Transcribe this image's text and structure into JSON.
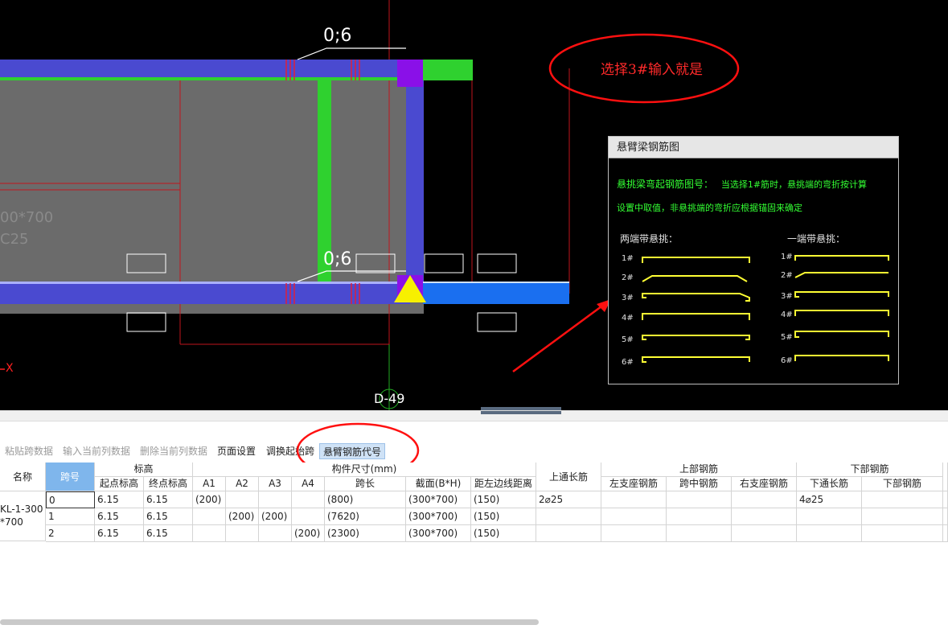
{
  "canvas": {
    "beam_label_top": "0;6",
    "beam_label_bottom": "0;6",
    "section_text": "00*700",
    "concrete_text": "C25",
    "axis_label": "D-49",
    "x_axis_label": "X"
  },
  "annotation": {
    "note": "选择3#输入就是"
  },
  "popup": {
    "title": "悬臂梁钢筋图",
    "desc_line1": "悬挑梁弯起钢筋图号：",
    "desc_line1_tail": "当选择1#筋时，悬挑端的弯折按计算",
    "desc_line2": "设置中取值，非悬挑端的弯折应根据锚固来确定",
    "group_left": "两端带悬挑：",
    "group_right": "一端带悬挑：",
    "left_labels": [
      "1#",
      "2#",
      "3#",
      "4#",
      "5#",
      "6#"
    ],
    "right_labels": [
      "1#",
      "2#",
      "3#",
      "4#",
      "5#",
      "6#"
    ]
  },
  "toolbar": {
    "paste": "粘贴跨数据",
    "input_col": "输入当前列数据",
    "delete_col": "删除当前列数据",
    "page_setup": "页面设置",
    "swap_start": "调换起始跨",
    "cantilever_code": "悬臂钢筋代号"
  },
  "table": {
    "h_name": "名称",
    "h_span": "跨号",
    "h_elev": "标高",
    "h_start_elev": "起点标高",
    "h_end_elev": "终点标高",
    "h_dims": "构件尺寸(mm)",
    "h_a1": "A1",
    "h_a2": "A2",
    "h_a3": "A3",
    "h_a4": "A4",
    "h_len": "跨长",
    "h_section": "截面(B*H)",
    "h_edge": "距左边线距离",
    "h_top_long": "上通长筋",
    "h_top_bar": "上部钢筋",
    "h_left_sup": "左支座钢筋",
    "h_mid": "跨中钢筋",
    "h_right_sup": "右支座钢筋",
    "h_bottom_bar": "下部钢筋",
    "h_bottom_long": "下通长筋",
    "h_bottom_sub": "下部钢筋",
    "name_value_1": "KL-1-300",
    "name_value_2": "*700",
    "rows": [
      {
        "span": "0",
        "start": "6.15",
        "end": "6.15",
        "a1": "(200)",
        "a2": "",
        "a3": "",
        "a4": "",
        "len": "(800)",
        "section": "(300*700)",
        "edge": "(150)",
        "top_long": "2⌀25",
        "bottom_long": "4⌀25"
      },
      {
        "span": "1",
        "start": "6.15",
        "end": "6.15",
        "a1": "",
        "a2": "(200)",
        "a3": "(200)",
        "a4": "",
        "len": "(7620)",
        "section": "(300*700)",
        "edge": "(150)",
        "top_long": "",
        "bottom_long": ""
      },
      {
        "span": "2",
        "start": "6.15",
        "end": "6.15",
        "a1": "",
        "a2": "",
        "a3": "",
        "a4": "(200)",
        "len": "(2300)",
        "section": "(300*700)",
        "edge": "(150)",
        "top_long": "",
        "bottom_long": ""
      }
    ]
  }
}
